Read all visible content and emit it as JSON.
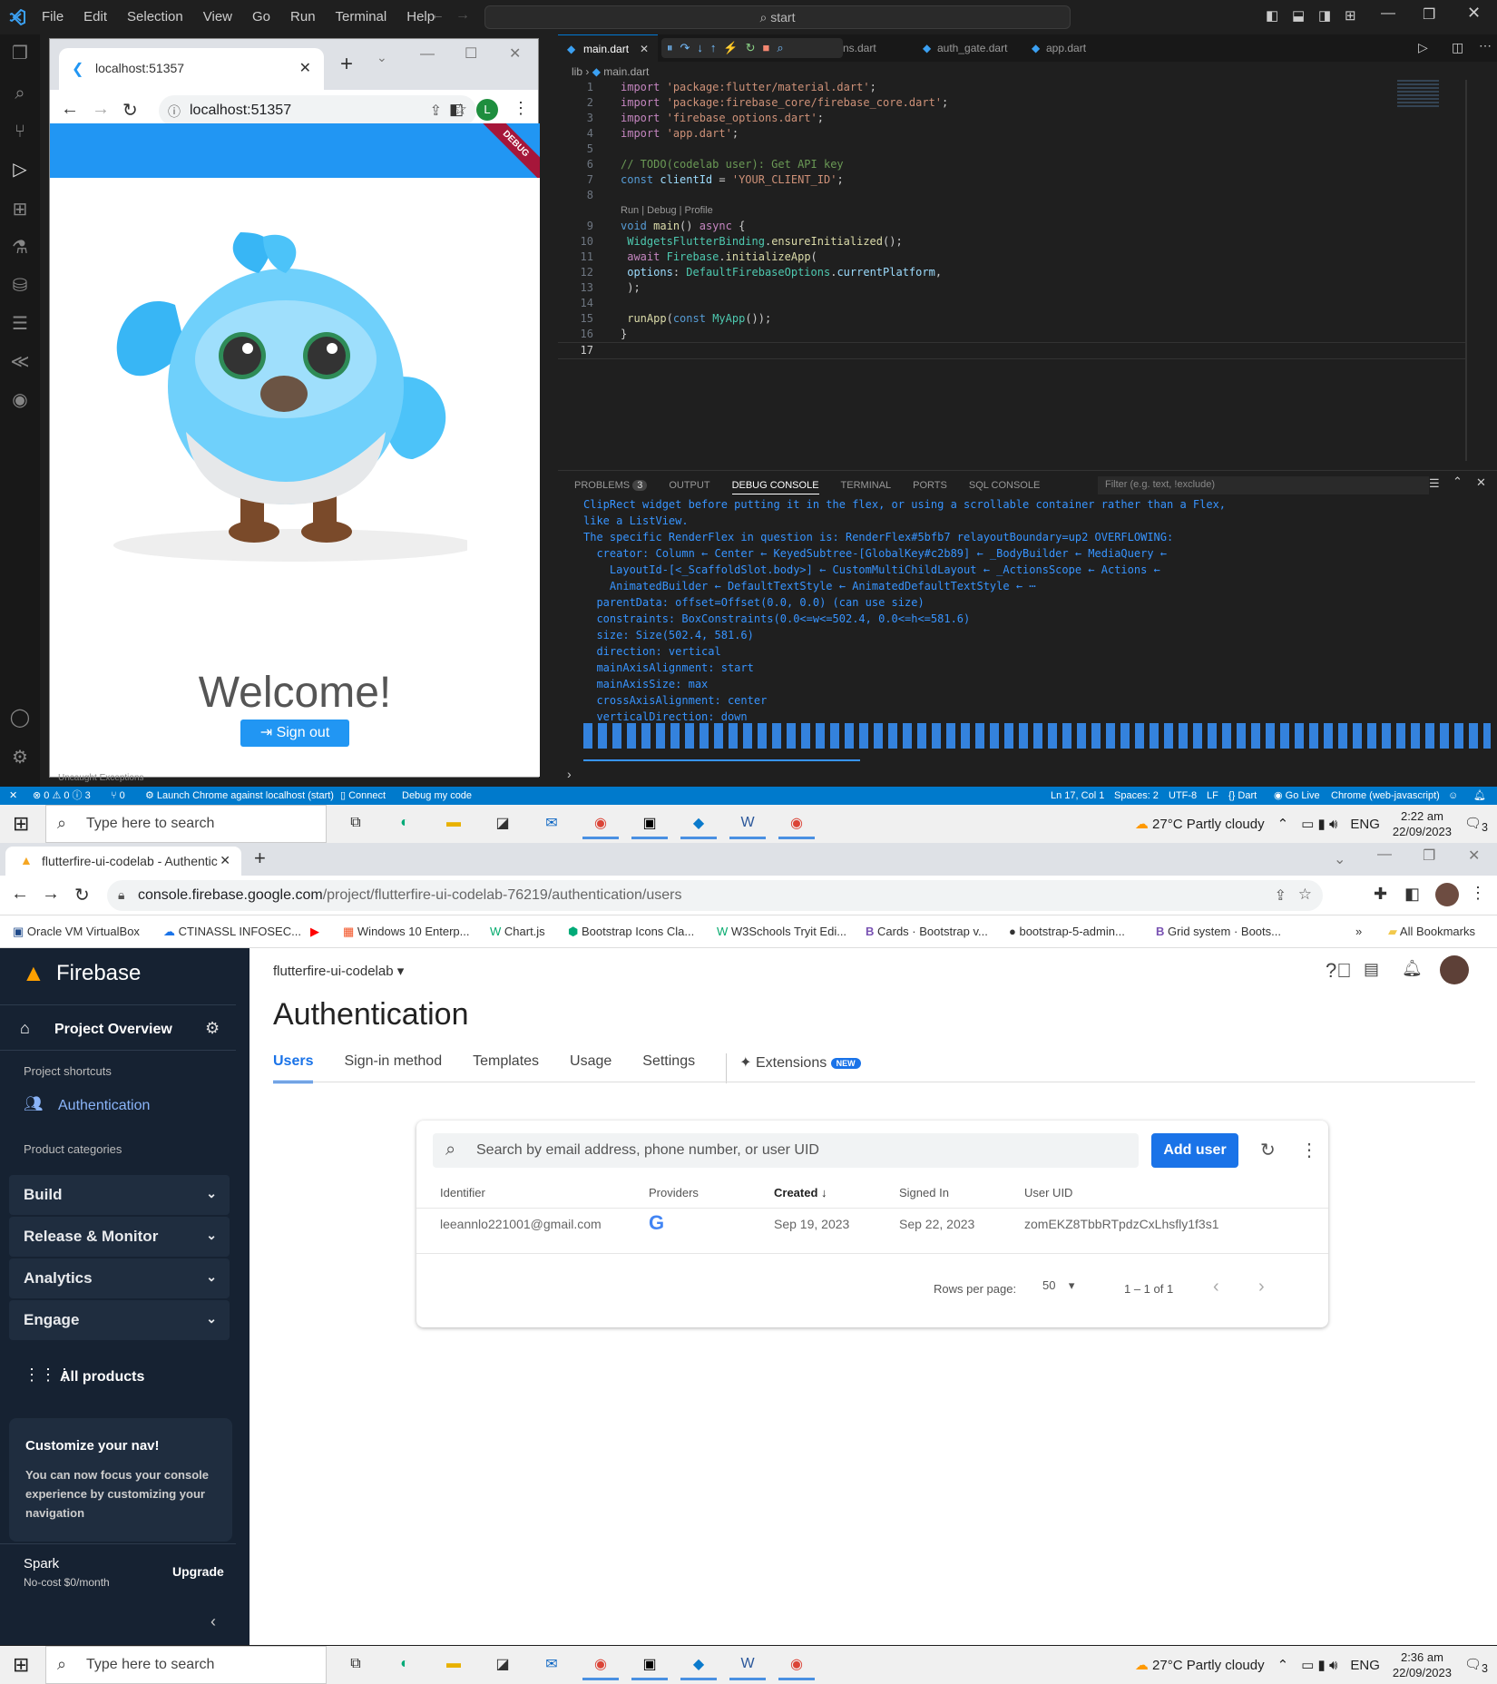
{
  "vscode": {
    "menu": [
      "File",
      "Edit",
      "Selection",
      "View",
      "Go",
      "Run",
      "Terminal",
      "Help"
    ],
    "search": "start",
    "tabs": [
      "main.dart",
      "ns.dart",
      "auth_gate.dart",
      "app.dart"
    ],
    "breadcrumb": [
      "lib",
      "main.dart"
    ],
    "code_lens": "Run | Debug | Profile",
    "code": [
      {
        "n": "1",
        "t": "import 'package:flutter/material.dart';"
      },
      {
        "n": "2",
        "t": "import 'package:firebase_core/firebase_core.dart';"
      },
      {
        "n": "3",
        "t": "import 'firebase_options.dart';"
      },
      {
        "n": "4",
        "t": "import 'app.dart';"
      },
      {
        "n": "5",
        "t": ""
      },
      {
        "n": "6",
        "t": "// TODO(codelab user): Get API key"
      },
      {
        "n": "7",
        "t": "const clientId = 'YOUR_CLIENT_ID';"
      },
      {
        "n": "8",
        "t": ""
      },
      {
        "n": "9",
        "t": "void main() async {"
      },
      {
        "n": "10",
        "t": "  WidgetsFlutterBinding.ensureInitialized();"
      },
      {
        "n": "11",
        "t": "  await Firebase.initializeApp("
      },
      {
        "n": "12",
        "t": "    options: DefaultFirebaseOptions.currentPlatform,"
      },
      {
        "n": "13",
        "t": "  );"
      },
      {
        "n": "14",
        "t": ""
      },
      {
        "n": "15",
        "t": "  runApp(const MyApp());"
      },
      {
        "n": "16",
        "t": "}"
      },
      {
        "n": "17",
        "t": ""
      }
    ],
    "panel_tabs": [
      "PROBLEMS",
      "OUTPUT",
      "DEBUG CONSOLE",
      "TERMINAL",
      "PORTS",
      "SQL CONSOLE"
    ],
    "problems_count": "3",
    "filter_placeholder": "Filter (e.g. text, !exclude)",
    "console": [
      "ClipRect widget before putting it in the flex, or using a scrollable container rather than a Flex,",
      "like a ListView.",
      "The specific RenderFlex in question is: RenderFlex#5bfb7 relayoutBoundary=up2 OVERFLOWING:",
      "  creator: Column ← Center ← KeyedSubtree-[GlobalKey#c2b89] ← _BodyBuilder ← MediaQuery ←",
      "    LayoutId-[<_ScaffoldSlot.body>] ← CustomMultiChildLayout ← _ActionsScope ← Actions ←",
      "    AnimatedBuilder ← DefaultTextStyle ← AnimatedDefaultTextStyle ← ⋯",
      "  parentData: offset=Offset(0.0, 0.0) (can use size)",
      "  constraints: BoxConstraints(0.0<=w<=502.4, 0.0<=h<=581.6)",
      "  size: Size(502.4, 581.6)",
      "  direction: vertical",
      "  mainAxisAlignment: start",
      "  mainAxisSize: max",
      "  crossAxisAlignment: center",
      "  verticalDirection: down"
    ],
    "status": {
      "left": [
        "⊗ 0 ⚠ 0 ⓘ 3",
        "⑂ 0",
        "Launch Chrome against localhost (start)",
        "Connect",
        "Debug my code"
      ],
      "right": [
        "Ln 17, Col 1",
        "Spaces: 2",
        "UTF-8",
        "LF",
        "{} Dart",
        "Go Live",
        "Chrome (web-javascript)"
      ]
    },
    "bottom_snippet": "Uncaught Exceptions"
  },
  "chrome_window": {
    "tab_title": "localhost:51357",
    "url": "localhost:51357",
    "avatar_letter": "L",
    "debug_label": "DEBUG",
    "welcome": "Welcome!",
    "sign_out": "Sign out"
  },
  "taskbar_top": {
    "search": "Type here to search",
    "weather": "27°C  Partly cloudy",
    "lang": "ENG",
    "time": "2:22 am",
    "date": "22/09/2023",
    "notif": "3"
  },
  "taskbar_bottom": {
    "search": "Type here to search",
    "weather": "27°C  Partly cloudy",
    "lang": "ENG",
    "time": "2:36 am",
    "date": "22/09/2023",
    "notif": "3"
  },
  "browser": {
    "tab_title": "flutterfire-ui-codelab - Authentic",
    "url_host": "console.firebase.google.com",
    "url_path": "/project/flutterfire-ui-codelab-76219/authentication/users",
    "bookmarks": [
      "Oracle VM VirtualBox",
      "CTINASSL INFOSEC...",
      "Windows 10 Enterp...",
      "Chart.js",
      "Bootstrap Icons Cla...",
      "W3Schools Tryit Edi...",
      "Cards · Bootstrap v...",
      "bootstrap-5-admin...",
      "Grid system · Boots..."
    ],
    "all_bookmarks": "All Bookmarks"
  },
  "firebase": {
    "brand": "Firebase",
    "project_overview": "Project Overview",
    "project_shortcuts": "Project shortcuts",
    "authentication": "Authentication",
    "product_categories": "Product categories",
    "categories": [
      "Build",
      "Release & Monitor",
      "Analytics",
      "Engage"
    ],
    "all_products": "All products",
    "customize_title": "Customize your nav!",
    "customize_body": "You can now focus your console experience by customizing your navigation",
    "plan": "Spark",
    "plan_sub": "No-cost $0/month",
    "upgrade": "Upgrade",
    "project": "flutterfire-ui-codelab",
    "page_title": "Authentication",
    "tabs": [
      "Users",
      "Sign-in method",
      "Templates",
      "Usage",
      "Settings",
      "Extensions"
    ],
    "new_badge": "NEW",
    "search_placeholder": "Search by email address, phone number, or user UID",
    "add_user": "Add user",
    "columns": [
      "Identifier",
      "Providers",
      "Created",
      "Signed In",
      "User UID"
    ],
    "row": {
      "identifier": "leeannlo221001@gmail.com",
      "created": "Sep 19, 2023",
      "signed_in": "Sep 22, 2023",
      "uid": "zomEKZ8TbbRTpdzCxLhsfly1f3s1"
    },
    "rows_per_page_label": "Rows per page:",
    "rows_per_page": "50",
    "range": "1 – 1 of 1"
  }
}
